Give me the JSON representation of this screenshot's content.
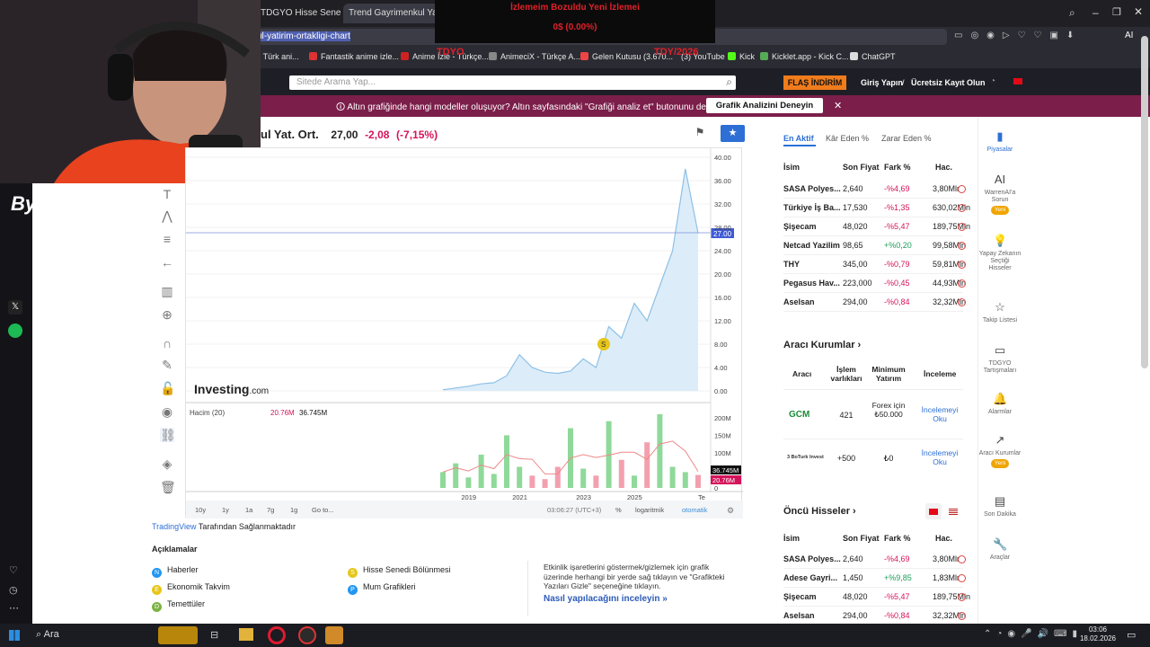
{
  "browser": {
    "tabs": [
      {
        "label": "TDGYO Hisse Senedi Fiyat"
      },
      {
        "label": "Trend Gayrimenkul Yatırım",
        "active": true
      }
    ],
    "new_tab": "+",
    "url": "ul-yatirim-ortakligi-chart",
    "ai_label": "AI",
    "bookmarks": [
      "| Türk ani...",
      "Fantastik anime izle...",
      "Anime İzle - Türkçe...",
      "AnimeciX - Türkçe A...",
      "Gelen Kutusu (3.670...",
      "(3) YouTube",
      "Kick",
      "Kicklet.app - Kick C...",
      "ChatGPT"
    ]
  },
  "stream": {
    "line1": "İzlemeim Bozuldu Yeni İzlemei",
    "line2": "0$ (0.00%)",
    "left_tag": "TDYO",
    "right_tag": "TDY/2026"
  },
  "webcam": {
    "brand": "ByBiz"
  },
  "site": {
    "search_placeholder": "Sitede Arama Yap...",
    "flash": "FLAŞ İNDİRİM",
    "login": "Giriş Yapın",
    "sep": "/",
    "register": "Ücretsiz Kayıt Olun",
    "promo_text": "🛈 Altın grafiğinde hangi modeller oluşuyor? Altın sayfasındaki \"Grafiği analiz et\" butonunu deneyin",
    "promo_button": "Grafik Analizini Deneyin",
    "promo_close": "✕"
  },
  "quote": {
    "name": "ul Yat. Ort.",
    "price": "27,00",
    "change": "-2,08",
    "pct": "(-7,15%)"
  },
  "chart": {
    "y_ticks": [
      "40.00",
      "36.00",
      "32.00",
      "28.00",
      "24.00",
      "20.00",
      "16.00",
      "12.00",
      "8.00",
      "4.00",
      "0.00"
    ],
    "last_price": "27.00",
    "vol_label": "Hacim (20)",
    "vol_val1": "20.76M",
    "vol_val2": "36.745M",
    "vol_ticks": [
      "200M",
      "150M",
      "100M",
      "50M",
      "0"
    ],
    "vol_tag1": "36.745M",
    "vol_tag2": "20.76M",
    "x_ticks": [
      "2019",
      "2021",
      "2023",
      "2025",
      "Te"
    ],
    "watermark": "Investing",
    "watermark_suffix": ".com",
    "event_marker": "S",
    "ranges": [
      "10y",
      "1y",
      "1a",
      "7g",
      "1g",
      "Go to..."
    ],
    "time": "03:06:27 (UTC+3)",
    "pct": "%",
    "log": "logaritmik",
    "auto": "otomatik"
  },
  "chart_data": {
    "type": "area",
    "x": [
      "2018-01",
      "2018-07",
      "2019-01",
      "2019-07",
      "2020-01",
      "2020-07",
      "2021-01",
      "2021-04",
      "2021-07",
      "2022-01",
      "2022-07",
      "2023-01",
      "2023-06",
      "2024-01",
      "2024-06",
      "2025-01",
      "2025-04",
      "2025-07",
      "2025-10",
      "2026-01",
      "2026-02"
    ],
    "values": [
      0.2,
      0.5,
      0.8,
      1.2,
      1.4,
      2.6,
      6.2,
      4.0,
      3.2,
      3.0,
      3.4,
      5.5,
      4.0,
      11.0,
      9.0,
      15.0,
      12.0,
      18.0,
      24.0,
      38.0,
      27.0
    ],
    "ylim": [
      0,
      40
    ],
    "grid": true,
    "volume": {
      "values": [
        45,
        70,
        30,
        95,
        40,
        150,
        60,
        35,
        25,
        60,
        170,
        55,
        35,
        190,
        80,
        35,
        130,
        210,
        60,
        45,
        36.745
      ]
    }
  },
  "legend": {
    "provider": "TradingView",
    "provider_suffix": "Tarafından Sağlanmaktadır",
    "title": "Açıklamalar",
    "items": [
      {
        "k": "N",
        "label": "Haberler",
        "color": "#2196f3"
      },
      {
        "k": "E",
        "label": "Ekonomik Takvim",
        "color": "#e6c619"
      },
      {
        "k": "D",
        "label": "Temettüler",
        "color": "#7cb342"
      },
      {
        "k": "S",
        "label": "Hisse Senedi Bölünmesi",
        "color": "#e6c619"
      },
      {
        "k": "P",
        "label": "Mum Grafikleri",
        "color": "#2196f3"
      }
    ],
    "info": "Etkinlik işaretlerini göstermek/gizlemek için grafik üzerinde herhangi bir yerde sağ tıklayın ve \"Grafikteki Yazıları Gizle\" seçeneğine tıklayın.",
    "howto": "Nasıl yapılacağını inceleyin »"
  },
  "right": {
    "tabs": [
      "En Aktif",
      "Kâr Eden %",
      "Zarar Eden %"
    ],
    "headers": [
      "İsim",
      "Son Fiyat",
      "Fark %",
      "Hac."
    ],
    "rows": [
      [
        "SASA Polyes...",
        "2,640",
        "-%4,69",
        "3,80Mlr",
        "neg"
      ],
      [
        "Türkiye İş Ba...",
        "17,530",
        "-%1,35",
        "630,02Mln",
        "neg"
      ],
      [
        "Şişecam",
        "48,020",
        "-%5,47",
        "189,75Mln",
        "neg"
      ],
      [
        "Netcad Yazilim",
        "98,65",
        "+%0,20",
        "99,58Mln",
        "pos"
      ],
      [
        "THY",
        "345,00",
        "-%0,79",
        "59,81Mln",
        "neg"
      ],
      [
        "Pegasus Hav...",
        "223,000",
        "-%0,45",
        "44,93Mln",
        "neg"
      ],
      [
        "Aselsan",
        "294,00",
        "-%0,84",
        "32,32Mln",
        "neg"
      ]
    ],
    "broker_title": "Aracı Kurumlar",
    "broker_headers": [
      "Aracı",
      "İşlem varlıkları",
      "Minimum Yatırım",
      "İnceleme"
    ],
    "brokers": [
      {
        "logo": "GCM",
        "assets": "421",
        "min": "Forex için ₺50.000",
        "review": "İncelemeyi Oku"
      },
      {
        "logo": "3 BoTurk Invest",
        "assets": "+500",
        "min": "₺0",
        "review": "İncelemeyi Oku"
      }
    ],
    "leaders_title": "Öncü Hisseler",
    "leader_rows": [
      [
        "SASA Polyes...",
        "2,640",
        "-%4,69",
        "3,80Mlr",
        "neg"
      ],
      [
        "Adese Gayri...",
        "1,450",
        "+%9,85",
        "1,83Mlr",
        "pos"
      ],
      [
        "Şişecam",
        "48,020",
        "-%5,47",
        "189,75Mln",
        "neg"
      ],
      [
        "Aselsan",
        "294,00",
        "-%0,84",
        "32,32Mln",
        "neg"
      ]
    ]
  },
  "nav": [
    {
      "label": "Piyasalar",
      "icon": "bar-chart-icon",
      "glyph": "▮"
    },
    {
      "label": "WarrenAI'a Sorun",
      "icon": "ai-icon",
      "glyph": "AI",
      "badge": "Yeni"
    },
    {
      "label": "Yapay Zekanın Seçtiği Hisseler",
      "icon": "bulb-icon",
      "glyph": "💡"
    },
    {
      "label": "Takip Listesi",
      "icon": "star-icon",
      "glyph": "☆"
    },
    {
      "label": "TDGYO Tartışmaları",
      "icon": "chat-icon",
      "glyph": "▭"
    },
    {
      "label": "Alarmlar",
      "icon": "bell-icon",
      "glyph": "🔔"
    },
    {
      "label": "Aracı Kurumlar",
      "icon": "trend-icon",
      "glyph": "↗",
      "badge": "Yeni"
    },
    {
      "label": "Son Dakika",
      "icon": "news-icon",
      "glyph": "▤"
    },
    {
      "label": "Araçlar",
      "icon": "wrench-icon",
      "glyph": "🔧"
    }
  ],
  "taskbar": {
    "search": "Ara",
    "time": "03:06",
    "date": "18.02.2026"
  }
}
